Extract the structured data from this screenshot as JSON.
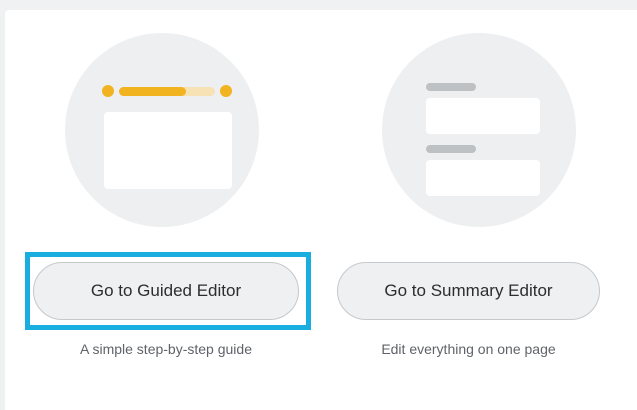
{
  "guided": {
    "button_label": "Go to Guided Editor",
    "caption": "A simple step-by-step guide",
    "progress": 0.7
  },
  "summary": {
    "button_label": "Go to Summary Editor",
    "caption": "Edit everything on one page"
  },
  "colors": {
    "accent": "#f2b321",
    "highlight": "#1aaee0"
  }
}
